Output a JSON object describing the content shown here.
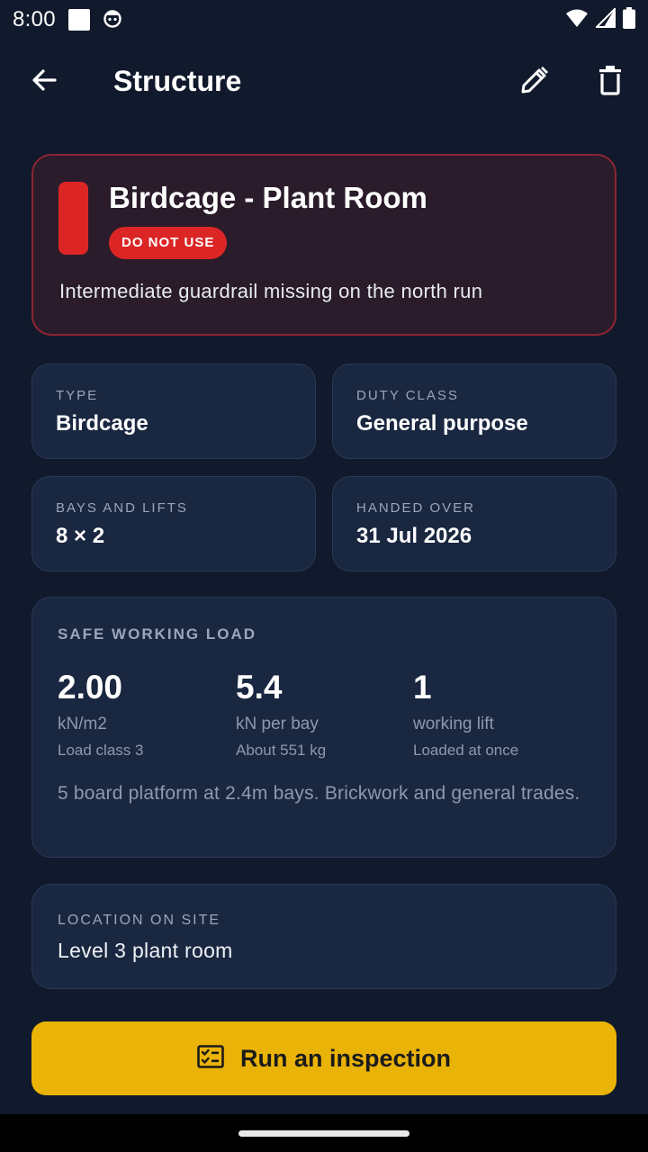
{
  "status_bar": {
    "time": "8:00"
  },
  "app_bar": {
    "title": "Structure"
  },
  "alert": {
    "title": "Birdcage - Plant Room",
    "badge": "DO NOT USE",
    "message": "Intermediate guardrail missing on the north run",
    "status_color": "#dc2626"
  },
  "details": [
    {
      "label": "TYPE",
      "value": "Birdcage"
    },
    {
      "label": "DUTY CLASS",
      "value": "General purpose"
    },
    {
      "label": "BAYS AND LIFTS",
      "value": "8 × 2"
    },
    {
      "label": "HANDED OVER",
      "value": "31 Jul 2026"
    }
  ],
  "safe_working_load": {
    "label": "SAFE WORKING LOAD",
    "metrics": [
      {
        "value": "2.00",
        "unit": "kN/m2",
        "sub": "Load class 3"
      },
      {
        "value": "5.4",
        "unit": "kN per bay",
        "sub": "About 551 kg"
      },
      {
        "value": "1",
        "unit": "working lift",
        "sub": "Loaded at once"
      }
    ],
    "description": "5 board platform at 2.4m bays. Brickwork and general trades."
  },
  "location": {
    "label": "LOCATION ON SITE",
    "value": "Level 3 plant room"
  },
  "primary_action": {
    "label": "Run an inspection",
    "icon": "checklist-icon",
    "color": "#eab308"
  },
  "icons": {
    "back": "arrow-left-icon",
    "edit": "pencil-icon",
    "delete": "trash-icon"
  }
}
